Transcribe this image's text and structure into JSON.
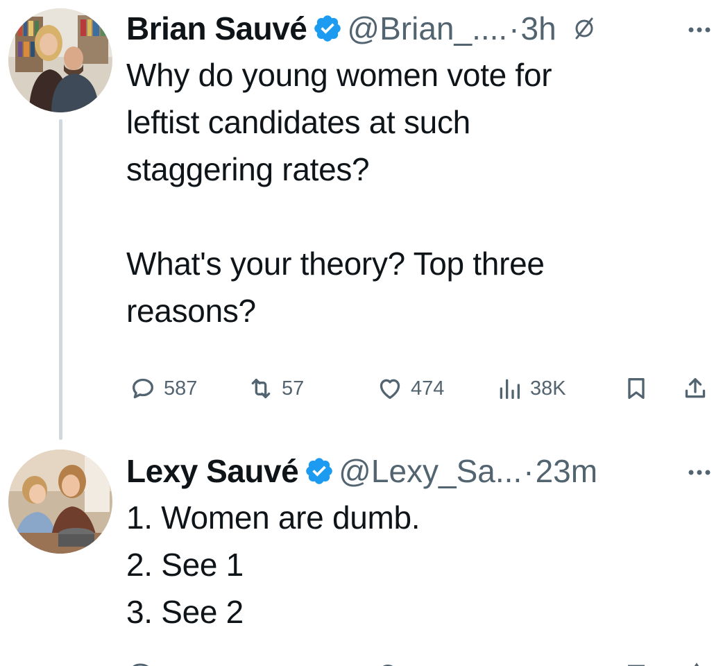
{
  "colors": {
    "verified": "#1d9bf0",
    "secondary_text": "#536471",
    "thread_line": "#cfd9de"
  },
  "tweet1": {
    "display_name": "Brian Sauvé",
    "verified_icon": "verified-badge-icon",
    "handle": "@Brian_....",
    "dot": "·",
    "timestamp": "3h",
    "grok_icon": "grok-icon",
    "more_icon": "more-icon",
    "text_lines_1": [
      "Why do young women vote for",
      "leftist candidates at such",
      "staggering rates?"
    ],
    "text_lines_2": [
      "What's your theory? Top three",
      "reasons?"
    ],
    "actions": {
      "reply_count": "587",
      "retweet_count": "57",
      "like_count": "474",
      "views_count": "38K"
    }
  },
  "tweet2": {
    "display_name": "Lexy Sauvé",
    "verified_icon": "verified-badge-icon",
    "handle": "@Lexy_Sa...",
    "dot": "·",
    "timestamp": "23m",
    "more_icon": "more-icon",
    "text_lines": [
      "1. Women are dumb.",
      "2. See 1",
      "3. See 2"
    ]
  }
}
